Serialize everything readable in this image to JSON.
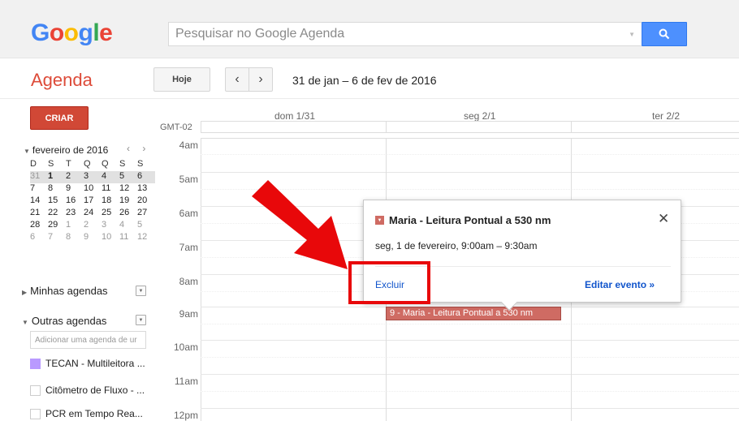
{
  "header": {
    "logo": [
      "G",
      "o",
      "o",
      "g",
      "l",
      "e"
    ],
    "search_placeholder": "Pesquisar no Google Agenda"
  },
  "toolbar": {
    "app_title": "Agenda",
    "today_label": "Hoje",
    "prev_label": "‹",
    "next_label": "›",
    "date_range": "31 de jan – 6 de fev de 2016"
  },
  "sidebar": {
    "create_label": "CRIAR",
    "mini_calendar": {
      "month_label": "fevereiro de 2016",
      "nav": "‹ ›",
      "weekday_headers": [
        "D",
        "S",
        "T",
        "Q",
        "Q",
        "S",
        "S"
      ],
      "weeks": [
        [
          "31",
          "1",
          "2",
          "3",
          "4",
          "5",
          "6"
        ],
        [
          "7",
          "8",
          "9",
          "10",
          "11",
          "12",
          "13"
        ],
        [
          "14",
          "15",
          "16",
          "17",
          "18",
          "19",
          "20"
        ],
        [
          "21",
          "22",
          "23",
          "24",
          "25",
          "26",
          "27"
        ],
        [
          "28",
          "29",
          "1",
          "2",
          "3",
          "4",
          "5"
        ],
        [
          "6",
          "7",
          "8",
          "9",
          "10",
          "11",
          "12"
        ]
      ]
    },
    "my_calendars_label": "Minhas agendas",
    "other_calendars_label": "Outras agendas",
    "add_calendar_placeholder": "Adicionar uma agenda de ur",
    "calendars": [
      {
        "name": "TECAN - Multileitora ...",
        "color": "#b99aff",
        "checked": true
      },
      {
        "name": "Citômetro de Fluxo - ...",
        "checked": false
      },
      {
        "name": "PCR em Tempo Rea...",
        "checked": false
      }
    ]
  },
  "calendar": {
    "timezone": "GMT-02",
    "days": [
      "dom 1/31",
      "seg 2/1",
      "ter 2/2"
    ],
    "hours": [
      "4am",
      "5am",
      "6am",
      "7am",
      "8am",
      "9am",
      "10am",
      "11am",
      "12pm"
    ],
    "event": {
      "label": "9 - Maria - Leitura Pontual a 530 nm",
      "color": "#cf6b63"
    }
  },
  "popup": {
    "title": "Maria - Leitura Pontual a 530 nm",
    "when": "seg, 1 de fevereiro, 9:00am – 9:30am",
    "close_label": "✕",
    "delete_label": "Excluir",
    "edit_label": "Editar evento »"
  },
  "annotation": {
    "highlight_color": "#e8080a"
  }
}
